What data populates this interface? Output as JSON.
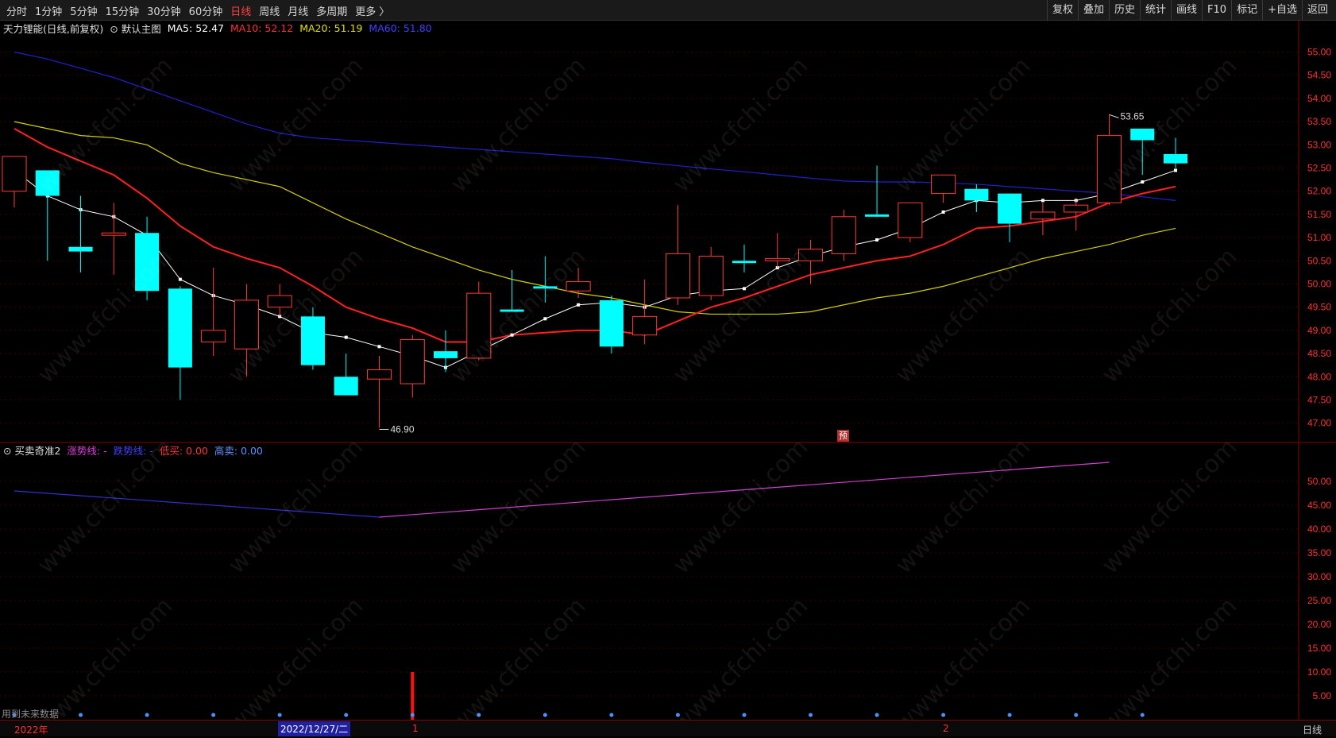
{
  "toolbar": {
    "periods": [
      "分时",
      "1分钟",
      "5分钟",
      "15分钟",
      "30分钟",
      "60分钟",
      "日线",
      "周线",
      "月线",
      "多周期",
      "更多 〉"
    ],
    "active_period": "日线",
    "actions": [
      "复权",
      "叠加",
      "历史",
      "统计",
      "画线",
      "F10",
      "标记",
      "+自选",
      "返回"
    ]
  },
  "main_legend": {
    "title": "天力锂能(日线,前复权)",
    "template": "默认主图",
    "ma5": "MA5: 52.47",
    "ma10": "MA10: 52.12",
    "ma20": "MA20: 51.19",
    "ma60": "MA60: 51.80"
  },
  "sub_legend": {
    "title": "买卖奇准2",
    "rise": "涨势线: -",
    "fall": "跌势线: -",
    "low_buy": "低买: 0.00",
    "high_sell": "高卖: 0.00"
  },
  "annotations": {
    "high_label": "53.65",
    "low_label": "46.90",
    "pred_badge": "预",
    "future_data": "用到未来数据"
  },
  "footer": {
    "year_label": "2022年",
    "cursor_date": "2022/12/27/二",
    "month1": "1",
    "month2": "2",
    "period_label": "日线"
  },
  "watermark": "www.cfchi.com",
  "colors": {
    "up": "#ff3a3a",
    "down": "#00ffff",
    "ma5": "#ffffff",
    "ma10": "#ff2020",
    "ma20": "#d4d000",
    "ma60": "#2020d0",
    "rise_line": "#d040d0",
    "fall_line": "#3030d0"
  },
  "chart_data": {
    "type": "candlestick",
    "price_axis": [
      55.0,
      54.5,
      54.0,
      53.5,
      53.0,
      52.5,
      52.0,
      51.5,
      51.0,
      50.5,
      50.0,
      49.5,
      49.0,
      48.5,
      48.0,
      47.5,
      47.0
    ],
    "price_ylim": [
      46.6,
      55.3
    ],
    "sub_axis": [
      50.0,
      45.0,
      40.0,
      35.0,
      30.0,
      25.0,
      20.0,
      15.0,
      10.0,
      5.0
    ],
    "sub_ylim": [
      0,
      55
    ],
    "candles": [
      [
        52.0,
        52.75,
        51.65,
        52.75
      ],
      [
        52.45,
        51.9,
        50.5,
        52.45
      ],
      [
        50.8,
        50.7,
        50.25,
        51.9
      ],
      [
        51.05,
        51.1,
        50.2,
        51.75
      ],
      [
        51.1,
        49.85,
        49.65,
        51.45
      ],
      [
        49.9,
        48.2,
        47.5,
        49.95
      ],
      [
        48.75,
        49.0,
        48.45,
        50.35
      ],
      [
        48.6,
        49.65,
        48.0,
        50.0
      ],
      [
        49.5,
        49.75,
        49.3,
        50.0
      ],
      [
        49.3,
        48.25,
        48.15,
        49.5
      ],
      [
        48.0,
        47.6,
        47.6,
        48.5
      ],
      [
        47.95,
        48.15,
        46.9,
        48.45
      ],
      [
        47.85,
        48.8,
        47.55,
        48.9
      ],
      [
        48.55,
        48.4,
        48.1,
        49.0
      ],
      [
        48.4,
        49.8,
        48.35,
        50.05
      ],
      [
        49.45,
        49.4,
        49.4,
        50.3
      ],
      [
        49.95,
        49.9,
        49.6,
        50.6
      ],
      [
        49.85,
        50.05,
        49.7,
        50.35
      ],
      [
        49.65,
        48.65,
        48.5,
        49.75
      ],
      [
        48.9,
        49.3,
        48.7,
        50.1
      ],
      [
        49.7,
        50.65,
        49.55,
        51.7
      ],
      [
        49.75,
        50.6,
        49.65,
        50.8
      ],
      [
        50.5,
        50.45,
        50.25,
        50.85
      ],
      [
        50.5,
        50.55,
        50.35,
        51.1
      ],
      [
        50.5,
        50.75,
        50.0,
        50.95
      ],
      [
        50.65,
        51.45,
        50.5,
        51.6
      ],
      [
        51.5,
        51.45,
        51.45,
        52.55
      ],
      [
        51.0,
        51.75,
        50.9,
        51.75
      ],
      [
        51.95,
        52.35,
        51.75,
        52.35
      ],
      [
        52.05,
        51.8,
        51.55,
        52.15
      ],
      [
        51.95,
        51.3,
        50.9,
        51.95
      ],
      [
        51.4,
        51.55,
        51.05,
        51.75
      ],
      [
        51.55,
        51.7,
        51.15,
        51.8
      ],
      [
        51.75,
        53.2,
        51.7,
        53.65
      ],
      [
        53.35,
        53.1,
        52.35,
        53.35
      ],
      [
        52.8,
        52.6,
        52.5,
        53.15
      ]
    ],
    "ma5": [
      52.45,
      51.9,
      51.6,
      51.45,
      51.05,
      50.1,
      49.75,
      49.55,
      49.3,
      48.95,
      48.85,
      48.65,
      48.45,
      48.2,
      48.55,
      48.9,
      49.25,
      49.55,
      49.6,
      49.5,
      49.75,
      49.85,
      49.9,
      50.35,
      50.6,
      50.8,
      50.95,
      51.2,
      51.55,
      51.8,
      51.75,
      51.8,
      51.8,
      51.95,
      52.2,
      52.45
    ],
    "ma10": [
      53.35,
      52.95,
      52.65,
      52.35,
      51.85,
      51.25,
      50.8,
      50.55,
      50.35,
      49.95,
      49.5,
      49.25,
      49.05,
      48.75,
      48.75,
      48.9,
      48.95,
      49.0,
      49.0,
      48.9,
      49.2,
      49.5,
      49.7,
      49.95,
      50.2,
      50.35,
      50.5,
      50.6,
      50.85,
      51.2,
      51.25,
      51.35,
      51.45,
      51.75,
      51.95,
      52.1
    ],
    "ma20": [
      53.5,
      53.35,
      53.2,
      53.15,
      53.0,
      52.6,
      52.4,
      52.25,
      52.1,
      51.75,
      51.4,
      51.1,
      50.8,
      50.55,
      50.3,
      50.1,
      49.95,
      49.8,
      49.7,
      49.55,
      49.4,
      49.35,
      49.35,
      49.35,
      49.4,
      49.55,
      49.7,
      49.8,
      49.95,
      50.15,
      50.35,
      50.55,
      50.7,
      50.85,
      51.05,
      51.2
    ],
    "ma60": [
      55.0,
      54.85,
      54.65,
      54.45,
      54.2,
      53.95,
      53.7,
      53.45,
      53.25,
      53.15,
      53.1,
      53.05,
      53.0,
      52.95,
      52.9,
      52.85,
      52.8,
      52.75,
      52.7,
      52.62,
      52.55,
      52.48,
      52.42,
      52.35,
      52.28,
      52.22,
      52.2,
      52.2,
      52.18,
      52.15,
      52.1,
      52.05,
      52.0,
      51.95,
      51.88,
      51.8
    ],
    "indicator_line_start": 48.0,
    "indicator_line_mid": 42.5,
    "indicator_line_end": 54.0,
    "signal_bar": {
      "index": 12,
      "value": 10.0
    }
  }
}
